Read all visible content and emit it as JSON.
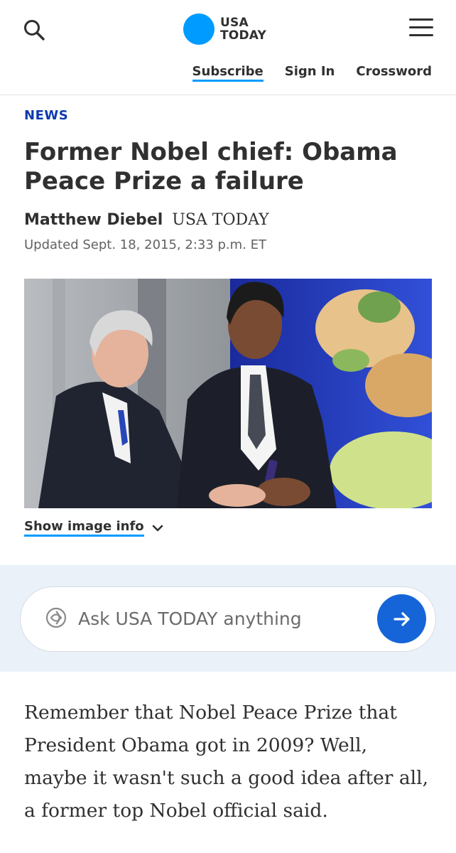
{
  "header": {
    "logo_line1": "USA",
    "logo_line2": "TODAY",
    "nav": {
      "subscribe": "Subscribe",
      "sign_in": "Sign In",
      "crossword": "Crossword"
    },
    "brand_color": "#009bff"
  },
  "article": {
    "section": "NEWS",
    "headline": "Former Nobel chief: Obama Peace Prize a failure",
    "author": "Matthew Diebel",
    "organization": "USA TODAY",
    "updated": "Updated Sept. 18, 2015, 2:33 p.m. ET",
    "image_info_label": "Show image info",
    "body": "Remember that Nobel Peace Prize that President Obama got in 2009? Well, maybe it wasn't such a good idea after all, a former top Nobel official said."
  },
  "ask": {
    "placeholder": "Ask USA TODAY anything",
    "button_color": "#1565d8"
  },
  "icons": {
    "search": "search-icon",
    "menu": "hamburger-menu-icon",
    "chevron": "chevron-down-icon",
    "ask": "ai-sparkle-icon",
    "submit": "arrow-right-icon"
  }
}
